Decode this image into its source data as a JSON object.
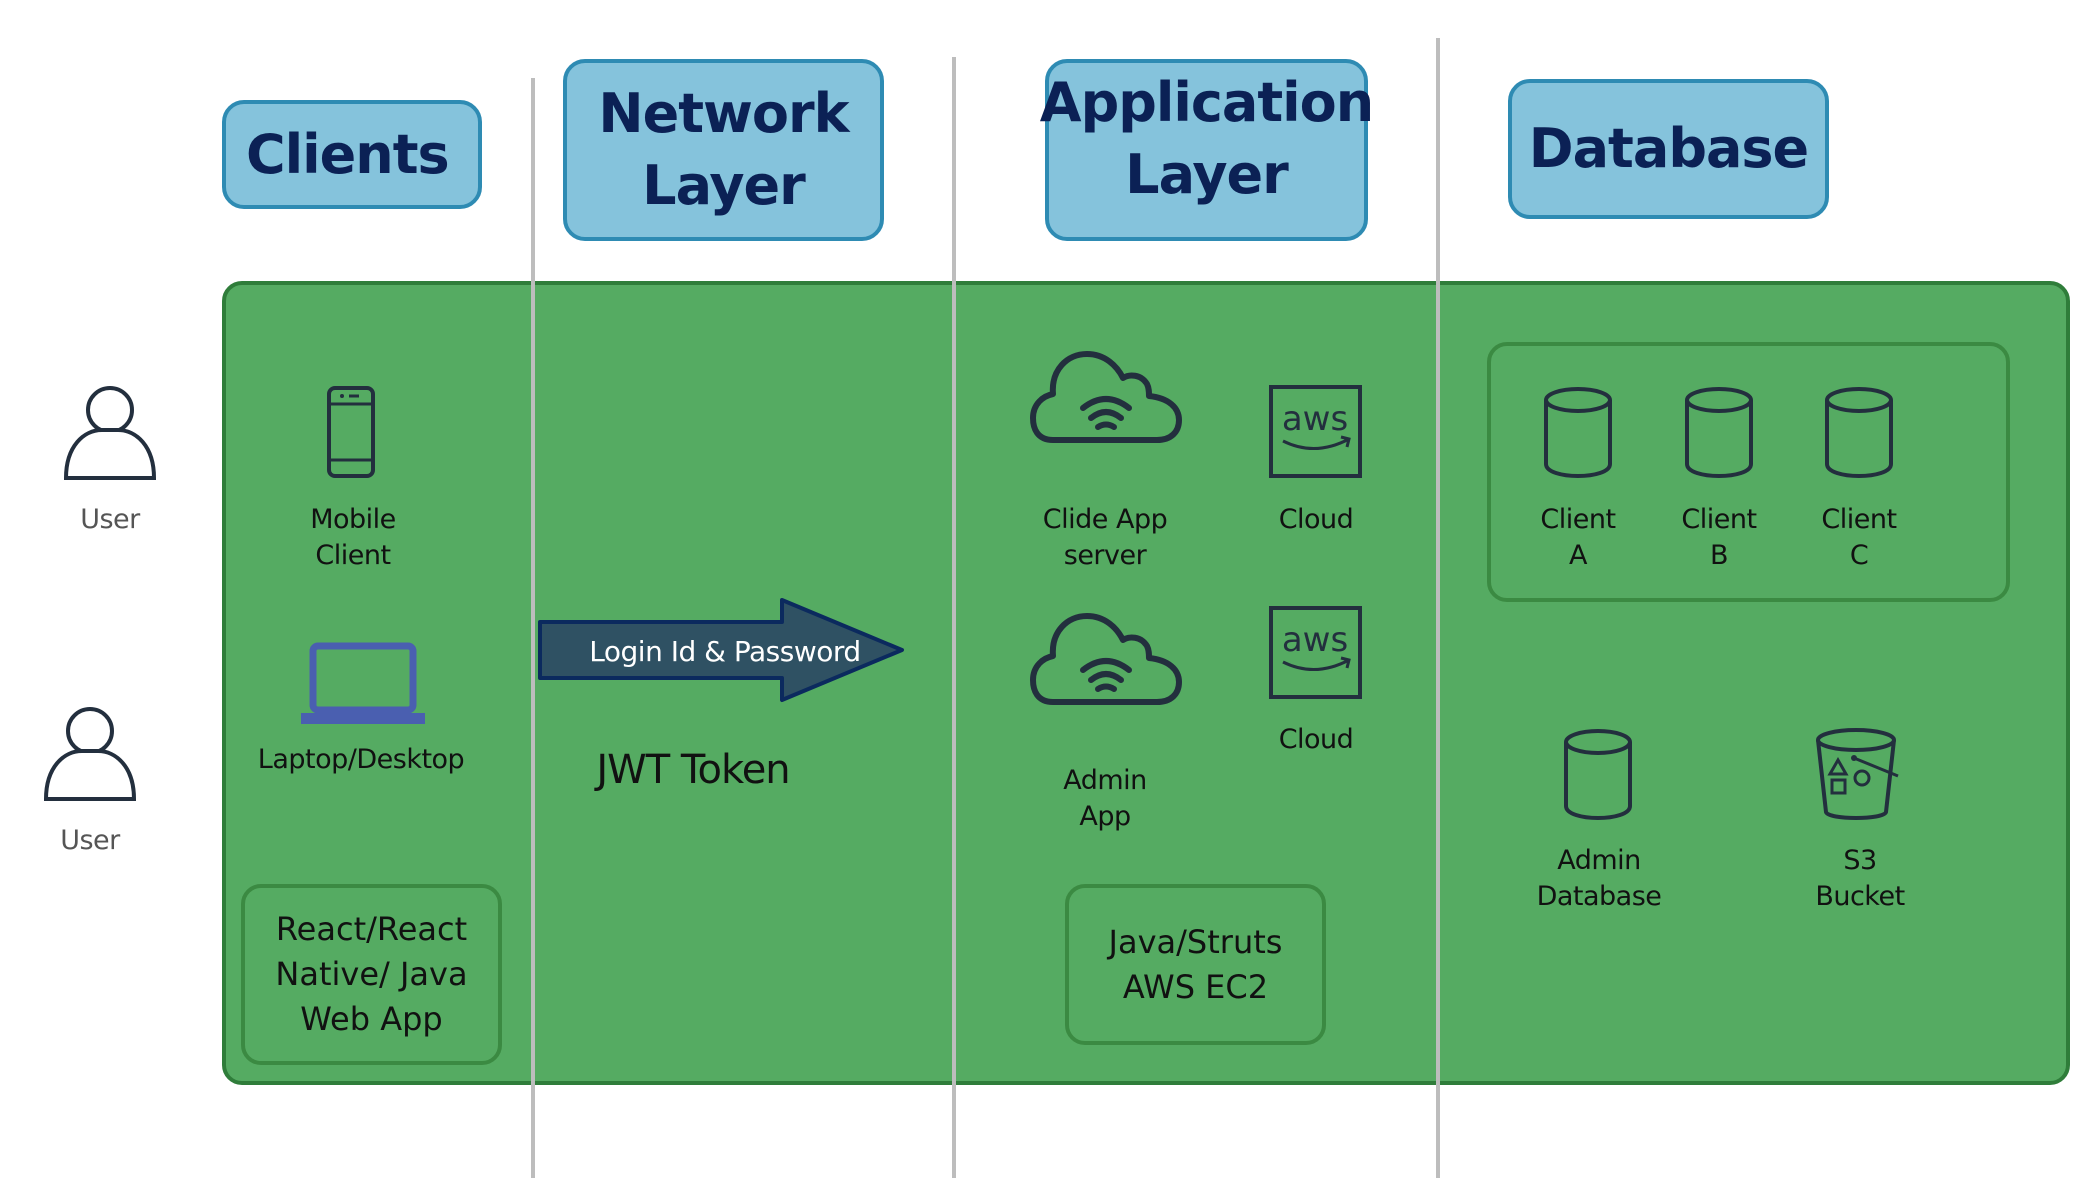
{
  "headers": {
    "clients": "Clients",
    "network_line1": "Network",
    "network_line2": "Layer",
    "application_line1": "Application",
    "application_line2": "Layer",
    "database": "Database"
  },
  "users": [
    {
      "label": "User",
      "icon": "user-icon"
    },
    {
      "label": "User",
      "icon": "user-icon"
    }
  ],
  "clients": {
    "mobile": {
      "line1": "Mobile",
      "line2": "Client",
      "icon": "mobile-phone-icon"
    },
    "laptop": {
      "label": "Laptop/Desktop",
      "icon": "laptop-icon"
    },
    "tech": {
      "line1": "React/React",
      "line2": "Native/ Java",
      "line3": "Web App"
    }
  },
  "network": {
    "arrow_label": "Login Id & Password",
    "token_label": "JWT Token"
  },
  "application": {
    "clide_server": {
      "line1": "Clide App",
      "line2": "server",
      "icon": "cloud-wifi-icon"
    },
    "cloud1": {
      "label": "Cloud",
      "icon": "aws-icon"
    },
    "admin_app": {
      "line1": "Admin",
      "line2": "App",
      "icon": "cloud-wifi-icon"
    },
    "cloud2": {
      "label": "Cloud",
      "icon": "aws-icon"
    },
    "tech": {
      "line1": "Java/Struts",
      "line2": "AWS EC2"
    }
  },
  "database": {
    "clients": [
      {
        "line1": "Client",
        "line2": "A",
        "icon": "database-icon"
      },
      {
        "line1": "Client",
        "line2": "B",
        "icon": "database-icon"
      },
      {
        "line1": "Client",
        "line2": "C",
        "icon": "database-icon"
      }
    ],
    "admin_db": {
      "line1": "Admin",
      "line2": "Database",
      "icon": "database-icon"
    },
    "s3": {
      "line1": "S3",
      "line2": "Bucket",
      "icon": "s3-bucket-icon"
    }
  },
  "colors": {
    "header_fill": "#85c3dc",
    "header_border": "#2e8bb3",
    "header_text": "#0b2155",
    "panel_green": "#55ab62",
    "icon_dark": "#232f3e",
    "arrow_fill": "#2f5163"
  }
}
